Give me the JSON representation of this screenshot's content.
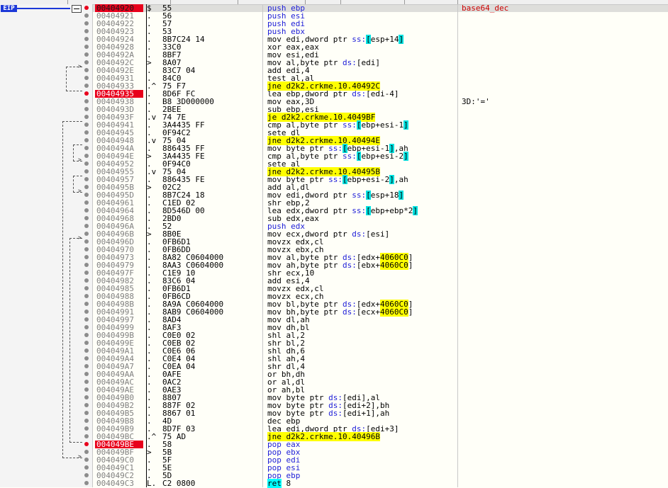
{
  "cpu": {
    "eip_label": "EIP",
    "rows": [
      {
        "addr": "00404920",
        "mk": "$",
        "bytes": "55",
        "ins": [
          [
            "m",
            "push"
          ],
          [
            "t",
            " "
          ],
          [
            "r",
            "ebp"
          ]
        ],
        "cmt": "base64_dec",
        "cmtfn": true,
        "bp": "eip",
        "dot": true
      },
      {
        "addr": "00404921",
        "mk": ".",
        "bytes": "56",
        "ins": [
          [
            "m",
            "push"
          ],
          [
            "t",
            " "
          ],
          [
            "r",
            "esi"
          ]
        ]
      },
      {
        "addr": "00404922",
        "mk": ".",
        "bytes": "57",
        "ins": [
          [
            "m",
            "push"
          ],
          [
            "t",
            " "
          ],
          [
            "r",
            "edi"
          ]
        ]
      },
      {
        "addr": "00404923",
        "mk": ".",
        "bytes": "53",
        "ins": [
          [
            "m",
            "push"
          ],
          [
            "t",
            " "
          ],
          [
            "r",
            "ebx"
          ]
        ]
      },
      {
        "addr": "00404924",
        "mk": ".",
        "bytes": "8B7C24 14",
        "ins": [
          [
            "t",
            "mov edi,dword ptr "
          ],
          [
            "s",
            "ss:"
          ],
          [
            "b",
            "["
          ],
          [
            "t",
            "esp+14"
          ],
          [
            "b",
            "]"
          ]
        ]
      },
      {
        "addr": "00404928",
        "mk": ".",
        "bytes": "33C0",
        "ins": [
          [
            "t",
            "xor eax,eax"
          ]
        ]
      },
      {
        "addr": "0040492A",
        "mk": ".",
        "bytes": "8BF7",
        "ins": [
          [
            "t",
            "mov esi,edi"
          ]
        ]
      },
      {
        "addr": "0040492C",
        "mk": ">",
        "bytes": "8A07",
        "ins": [
          [
            "t",
            "mov al,byte ptr "
          ],
          [
            "s",
            "ds:"
          ],
          [
            "t",
            "[edi]"
          ]
        ]
      },
      {
        "addr": "0040492E",
        "mk": ".",
        "bytes": "83C7 04",
        "ins": [
          [
            "t",
            "add edi,4"
          ]
        ]
      },
      {
        "addr": "00404931",
        "mk": ".",
        "bytes": "84C0",
        "ins": [
          [
            "t",
            "test al,al"
          ]
        ]
      },
      {
        "addr": "00404933",
        "mk": ".^",
        "bytes": "75 F7",
        "ins": [
          [
            "j",
            "jne d2k2.crkme.10.40492C"
          ]
        ]
      },
      {
        "addr": "00404935",
        "mk": ".",
        "bytes": "8D6F FC",
        "ins": [
          [
            "t",
            "lea ebp,dword ptr "
          ],
          [
            "s",
            "ds:"
          ],
          [
            "t",
            "[edi-4]"
          ]
        ],
        "bp": "bp",
        "dot": true
      },
      {
        "addr": "00404938",
        "mk": ".",
        "bytes": "B8 3D000000",
        "ins": [
          [
            "t",
            "mov eax,3D"
          ]
        ],
        "cmt": "3D:'='"
      },
      {
        "addr": "0040493D",
        "mk": ".",
        "bytes": "2BEE",
        "ins": [
          [
            "t",
            "sub ebp,esi"
          ]
        ]
      },
      {
        "addr": "0040493F",
        "mk": ".v",
        "bytes": "74 7E",
        "ins": [
          [
            "j",
            "je d2k2.crkme.10.4049BF"
          ]
        ]
      },
      {
        "addr": "00404941",
        "mk": ".",
        "bytes": "3A4435 FF",
        "ins": [
          [
            "t",
            "cmp al,byte ptr "
          ],
          [
            "s",
            "ss:"
          ],
          [
            "b",
            "["
          ],
          [
            "t",
            "ebp+esi-1"
          ],
          [
            "b",
            "]"
          ]
        ]
      },
      {
        "addr": "00404945",
        "mk": ".",
        "bytes": "0F94C2",
        "ins": [
          [
            "t",
            "sete dl"
          ]
        ]
      },
      {
        "addr": "00404948",
        "mk": ".v",
        "bytes": "75 04",
        "ins": [
          [
            "j",
            "jne d2k2.crkme.10.40494E"
          ]
        ]
      },
      {
        "addr": "0040494A",
        "mk": ".",
        "bytes": "886435 FF",
        "ins": [
          [
            "t",
            "mov byte ptr "
          ],
          [
            "s",
            "ss:"
          ],
          [
            "b",
            "["
          ],
          [
            "t",
            "ebp+esi-1"
          ],
          [
            "b",
            "]"
          ],
          [
            "t",
            ",ah"
          ]
        ]
      },
      {
        "addr": "0040494E",
        "mk": ">",
        "bytes": "3A4435 FE",
        "ins": [
          [
            "t",
            "cmp al,byte ptr "
          ],
          [
            "s",
            "ss:"
          ],
          [
            "b",
            "["
          ],
          [
            "t",
            "ebp+esi-2"
          ],
          [
            "b",
            "]"
          ]
        ]
      },
      {
        "addr": "00404952",
        "mk": ".",
        "bytes": "0F94C0",
        "ins": [
          [
            "t",
            "sete al"
          ]
        ]
      },
      {
        "addr": "00404955",
        "mk": ".v",
        "bytes": "75 04",
        "ins": [
          [
            "j",
            "jne d2k2.crkme.10.40495B"
          ]
        ]
      },
      {
        "addr": "00404957",
        "mk": ".",
        "bytes": "886435 FE",
        "ins": [
          [
            "t",
            "mov byte ptr "
          ],
          [
            "s",
            "ss:"
          ],
          [
            "b",
            "["
          ],
          [
            "t",
            "ebp+esi-2"
          ],
          [
            "b",
            "]"
          ],
          [
            "t",
            ",ah"
          ]
        ]
      },
      {
        "addr": "0040495B",
        "mk": ">",
        "bytes": "02C2",
        "ins": [
          [
            "t",
            "add al,dl"
          ]
        ]
      },
      {
        "addr": "0040495D",
        "mk": ".",
        "bytes": "8B7C24 18",
        "ins": [
          [
            "t",
            "mov edi,dword ptr "
          ],
          [
            "s",
            "ss:"
          ],
          [
            "b",
            "["
          ],
          [
            "t",
            "esp+18"
          ],
          [
            "b",
            "]"
          ]
        ]
      },
      {
        "addr": "00404961",
        "mk": ".",
        "bytes": "C1ED 02",
        "ins": [
          [
            "t",
            "shr ebp,2"
          ]
        ]
      },
      {
        "addr": "00404964",
        "mk": ".",
        "bytes": "8D546D 00",
        "ins": [
          [
            "t",
            "lea edx,dword ptr "
          ],
          [
            "s",
            "ss:"
          ],
          [
            "b",
            "["
          ],
          [
            "t",
            "ebp+ebp*2"
          ],
          [
            "b",
            "]"
          ]
        ]
      },
      {
        "addr": "00404968",
        "mk": ".",
        "bytes": "2BD0",
        "ins": [
          [
            "t",
            "sub edx,eax"
          ]
        ]
      },
      {
        "addr": "0040496A",
        "mk": ".",
        "bytes": "52",
        "ins": [
          [
            "m",
            "push"
          ],
          [
            "t",
            " "
          ],
          [
            "r",
            "edx"
          ]
        ]
      },
      {
        "addr": "0040496B",
        "mk": ">",
        "bytes": "8B0E",
        "ins": [
          [
            "t",
            "mov ecx,dword ptr "
          ],
          [
            "s",
            "ds:"
          ],
          [
            "t",
            "[esi]"
          ]
        ]
      },
      {
        "addr": "0040496D",
        "mk": ".",
        "bytes": "0FB6D1",
        "ins": [
          [
            "t",
            "movzx edx,cl"
          ]
        ]
      },
      {
        "addr": "00404970",
        "mk": ".",
        "bytes": "0FB6DD",
        "ins": [
          [
            "t",
            "movzx ebx,ch"
          ]
        ]
      },
      {
        "addr": "00404973",
        "mk": ".",
        "bytes": "8A82 C0604000",
        "ins": [
          [
            "t",
            "mov al,byte ptr "
          ],
          [
            "s",
            "ds:"
          ],
          [
            "t",
            "[edx+"
          ],
          [
            "h",
            "4060C0"
          ],
          [
            "t",
            "]"
          ]
        ]
      },
      {
        "addr": "00404979",
        "mk": ".",
        "bytes": "8AA3 C0604000",
        "ins": [
          [
            "t",
            "mov ah,byte ptr "
          ],
          [
            "s",
            "ds:"
          ],
          [
            "t",
            "[ebx+"
          ],
          [
            "h",
            "4060C0"
          ],
          [
            "t",
            "]"
          ]
        ]
      },
      {
        "addr": "0040497F",
        "mk": ".",
        "bytes": "C1E9 10",
        "ins": [
          [
            "t",
            "shr ecx,10"
          ]
        ]
      },
      {
        "addr": "00404982",
        "mk": ".",
        "bytes": "83C6 04",
        "ins": [
          [
            "t",
            "add esi,4"
          ]
        ]
      },
      {
        "addr": "00404985",
        "mk": ".",
        "bytes": "0FB6D1",
        "ins": [
          [
            "t",
            "movzx edx,cl"
          ]
        ]
      },
      {
        "addr": "00404988",
        "mk": ".",
        "bytes": "0FB6CD",
        "ins": [
          [
            "t",
            "movzx ecx,ch"
          ]
        ]
      },
      {
        "addr": "0040498B",
        "mk": ".",
        "bytes": "8A9A C0604000",
        "ins": [
          [
            "t",
            "mov bl,byte ptr "
          ],
          [
            "s",
            "ds:"
          ],
          [
            "t",
            "[edx+"
          ],
          [
            "h",
            "4060C0"
          ],
          [
            "t",
            "]"
          ]
        ]
      },
      {
        "addr": "00404991",
        "mk": ".",
        "bytes": "8AB9 C0604000",
        "ins": [
          [
            "t",
            "mov bh,byte ptr "
          ],
          [
            "s",
            "ds:"
          ],
          [
            "t",
            "[ecx+"
          ],
          [
            "h",
            "4060C0"
          ],
          [
            "t",
            "]"
          ]
        ]
      },
      {
        "addr": "00404997",
        "mk": ".",
        "bytes": "8AD4",
        "ins": [
          [
            "t",
            "mov dl,ah"
          ]
        ]
      },
      {
        "addr": "00404999",
        "mk": ".",
        "bytes": "8AF3",
        "ins": [
          [
            "t",
            "mov dh,bl"
          ]
        ]
      },
      {
        "addr": "0040499B",
        "mk": ".",
        "bytes": "C0E0 02",
        "ins": [
          [
            "t",
            "shl al,2"
          ]
        ]
      },
      {
        "addr": "0040499E",
        "mk": ".",
        "bytes": "C0EB 02",
        "ins": [
          [
            "t",
            "shr bl,2"
          ]
        ]
      },
      {
        "addr": "004049A1",
        "mk": ".",
        "bytes": "C0E6 06",
        "ins": [
          [
            "t",
            "shl dh,6"
          ]
        ]
      },
      {
        "addr": "004049A4",
        "mk": ".",
        "bytes": "C0E4 04",
        "ins": [
          [
            "t",
            "shl ah,4"
          ]
        ]
      },
      {
        "addr": "004049A7",
        "mk": ".",
        "bytes": "C0EA 04",
        "ins": [
          [
            "t",
            "shr dl,4"
          ]
        ]
      },
      {
        "addr": "004049AA",
        "mk": ".",
        "bytes": "0AFE",
        "ins": [
          [
            "t",
            "or bh,dh"
          ]
        ]
      },
      {
        "addr": "004049AC",
        "mk": ".",
        "bytes": "0AC2",
        "ins": [
          [
            "t",
            "or al,dl"
          ]
        ]
      },
      {
        "addr": "004049AE",
        "mk": ".",
        "bytes": "0AE3",
        "ins": [
          [
            "t",
            "or ah,bl"
          ]
        ]
      },
      {
        "addr": "004049B0",
        "mk": ".",
        "bytes": "8807",
        "ins": [
          [
            "t",
            "mov byte ptr "
          ],
          [
            "s",
            "ds:"
          ],
          [
            "t",
            "[edi],al"
          ]
        ]
      },
      {
        "addr": "004049B2",
        "mk": ".",
        "bytes": "887F 02",
        "ins": [
          [
            "t",
            "mov byte ptr "
          ],
          [
            "s",
            "ds:"
          ],
          [
            "t",
            "[edi+2],bh"
          ]
        ]
      },
      {
        "addr": "004049B5",
        "mk": ".",
        "bytes": "8867 01",
        "ins": [
          [
            "t",
            "mov byte ptr "
          ],
          [
            "s",
            "ds:"
          ],
          [
            "t",
            "[edi+1],ah"
          ]
        ]
      },
      {
        "addr": "004049B8",
        "mk": ".",
        "bytes": "4D",
        "ins": [
          [
            "t",
            "dec ebp"
          ]
        ]
      },
      {
        "addr": "004049B9",
        "mk": ".",
        "bytes": "8D7F 03",
        "ins": [
          [
            "t",
            "lea edi,dword ptr "
          ],
          [
            "s",
            "ds:"
          ],
          [
            "t",
            "[edi+3]"
          ]
        ]
      },
      {
        "addr": "004049BC",
        "mk": ".^",
        "bytes": "75 AD",
        "ins": [
          [
            "j",
            "jne d2k2.crkme.10.40496B"
          ]
        ]
      },
      {
        "addr": "004049BE",
        "mk": ".",
        "bytes": "58",
        "ins": [
          [
            "m",
            "pop"
          ],
          [
            "t",
            " "
          ],
          [
            "r",
            "eax"
          ]
        ],
        "bp": "bp",
        "dot": true
      },
      {
        "addr": "004049BF",
        "mk": ">",
        "bytes": "5B",
        "ins": [
          [
            "m",
            "pop"
          ],
          [
            "t",
            " "
          ],
          [
            "r",
            "ebx"
          ]
        ]
      },
      {
        "addr": "004049C0",
        "mk": ".",
        "bytes": "5F",
        "ins": [
          [
            "m",
            "pop"
          ],
          [
            "t",
            " "
          ],
          [
            "r",
            "edi"
          ]
        ]
      },
      {
        "addr": "004049C1",
        "mk": ".",
        "bytes": "5E",
        "ins": [
          [
            "m",
            "pop"
          ],
          [
            "t",
            " "
          ],
          [
            "r",
            "esi"
          ]
        ]
      },
      {
        "addr": "004049C2",
        "mk": ".",
        "bytes": "5D",
        "ins": [
          [
            "m",
            "pop"
          ],
          [
            "t",
            " "
          ],
          [
            "r",
            "ebp"
          ]
        ]
      },
      {
        "addr": "004049C3",
        "mk": "L.",
        "bytes": "C2 0800",
        "ins": [
          [
            "x",
            "ret"
          ],
          [
            "t",
            " 8"
          ]
        ]
      }
    ]
  }
}
